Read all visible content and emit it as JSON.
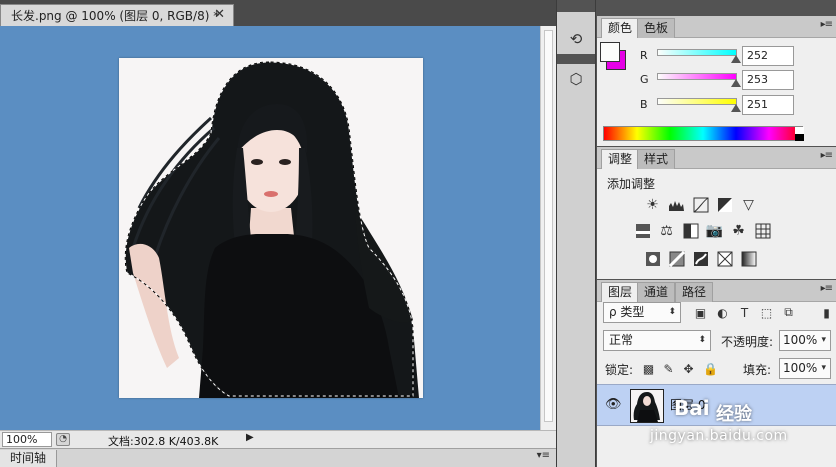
{
  "document": {
    "tab_title": "长发.png @ 100% (图层 0, RGB/8) *",
    "close_glyph": "✕",
    "zoom": "100%",
    "doc_info": "文档:302.8 K/403.8K",
    "status_arrow": "▶"
  },
  "timeline": {
    "tab": "时间轴",
    "menu": "▾≡"
  },
  "tool_column": [
    {
      "name": "history-icon",
      "glyph": "⟲"
    },
    {
      "name": "3d-icon",
      "glyph": "⬡"
    }
  ],
  "color_panel": {
    "tabs": [
      "颜色",
      "色板"
    ],
    "menu": "▸≡",
    "channels": [
      {
        "label": "R",
        "value": "252",
        "level": 252,
        "color": "#00ffff"
      },
      {
        "label": "G",
        "value": "253",
        "level": 253,
        "color": "#ff00ff"
      },
      {
        "label": "B",
        "value": "251",
        "level": 251,
        "color": "#ffff00"
      }
    ],
    "foreground": "#fcfdfb",
    "background": "#e600e6"
  },
  "adjustments_panel": {
    "tabs": [
      "调整",
      "样式"
    ],
    "title": "添加调整"
  },
  "layers_panel": {
    "tabs": [
      "图层",
      "通道",
      "路径"
    ],
    "filter_kind": "ρ 类型",
    "blend_mode": "正常",
    "opacity_label": "不透明度:",
    "opacity_value": "100%",
    "lock_label": "锁定:",
    "fill_label": "填充:",
    "fill_value": "100%",
    "layer_name": "图层 0"
  },
  "watermark": {
    "logo": "Bai",
    "text": "经验",
    "url": "jingyan.baidu.com"
  },
  "colors": {
    "canvas_bg": "#5b8ec2",
    "layer_selected": "#bdd1f3",
    "panel_bg": "#efefef"
  }
}
